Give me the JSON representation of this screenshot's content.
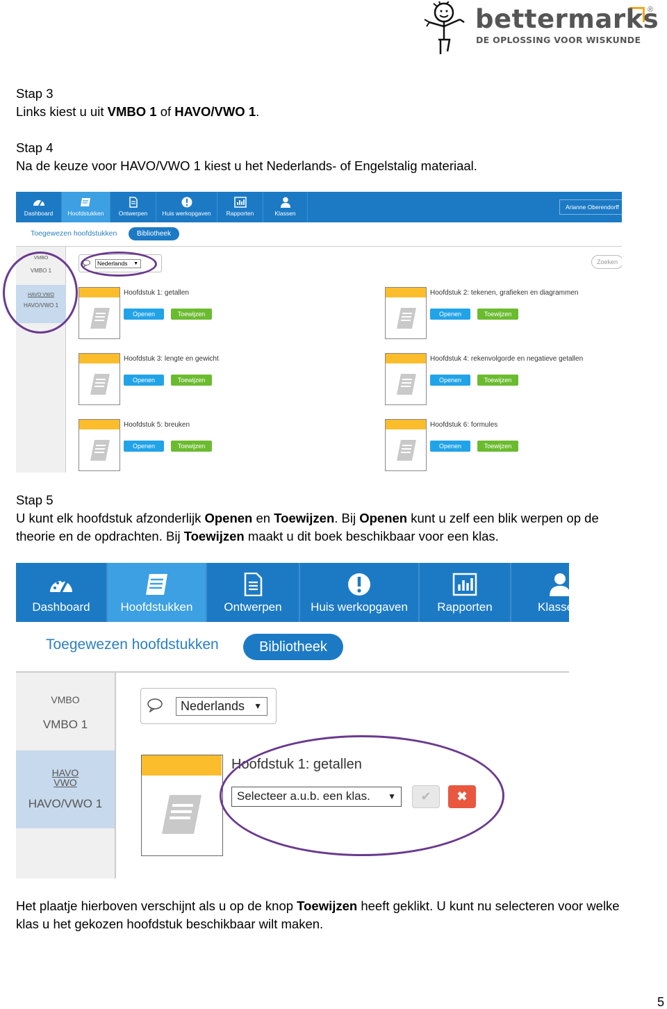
{
  "logo": {
    "word": "bettermarks",
    "reg": "®",
    "tagline": "DE OPLOSSING VOOR WISKUNDE"
  },
  "step3": {
    "title": "Stap 3",
    "line_pre": "Links kiest u uit ",
    "opt1": "VMBO 1",
    "mid": " of ",
    "opt2": "HAVO/VWO 1",
    "end": "."
  },
  "step4": {
    "title": "Stap 4",
    "text": "Na de keuze voor HAVO/VWO 1 kiest u het Nederlands- of Engelstalig materiaal."
  },
  "shot1": {
    "nav": [
      {
        "label": "Dashboard",
        "icon": "dashboard-icon"
      },
      {
        "label": "Hoofdstukken",
        "icon": "book-icon"
      },
      {
        "label": "Ontwerpen",
        "icon": "document-icon"
      },
      {
        "label": "Huis werkopgaven",
        "icon": "exclamation-icon"
      },
      {
        "label": "Rapporten",
        "icon": "bar-chart-icon"
      },
      {
        "label": "Klassen",
        "icon": "person-icon"
      }
    ],
    "user": "Arianne Oberendorff",
    "tab_assigned": "Toegewezen hoofdstukken",
    "tab_library": "Bibliotheek",
    "sidebar": [
      {
        "head": "VMBO",
        "label": "VMBO 1"
      },
      {
        "head": "HAVO VWO",
        "label": "HAVO/VWO 1"
      }
    ],
    "language": "Nederlands",
    "search_placeholder": "Zoeken",
    "open_label": "Openen",
    "assign_label": "Toewijzen",
    "chapters": [
      "Hoofdstuk 1: getallen",
      "Hoofdstuk 2: tekenen, grafieken en diagrammen",
      "Hoofdstuk 3: lengte en gewicht",
      "Hoofdstuk 4: rekenvolgorde en negatieve getallen",
      "Hoofdstuk 5: breuken",
      "Hoofdstuk 6: formules"
    ]
  },
  "step5": {
    "title": "Stap 5",
    "l1_a": "U kunt elk hoofdstuk afzonderlijk ",
    "l1_b": "Openen",
    "l1_c": " en ",
    "l1_d": "Toewijzen",
    "l1_e": ". Bij ",
    "l1_f": "Openen",
    "l1_g": " kunt u zelf een blik werpen op de",
    "l2_a": "theorie en de opdrachten. Bij ",
    "l2_b": "Toewijzen",
    "l2_c": " maakt u dit boek beschikbaar voor een klas."
  },
  "shot2": {
    "nav": [
      {
        "label": "Dashboard",
        "icon": "dashboard-icon"
      },
      {
        "label": "Hoofdstukken",
        "icon": "book-icon"
      },
      {
        "label": "Ontwerpen",
        "icon": "document-icon"
      },
      {
        "label": "Huis werkopgaven",
        "icon": "exclamation-icon"
      },
      {
        "label": "Rapporten",
        "icon": "bar-chart-icon"
      },
      {
        "label": "Klasse",
        "icon": "person-icon"
      }
    ],
    "tab_assigned": "Toegewezen hoofdstukken",
    "tab_library": "Bibliotheek",
    "sidebar": [
      {
        "head": "VMBO",
        "label": "VMBO 1"
      },
      {
        "head1": "HAVO",
        "head2": "VWO",
        "label": "HAVO/VWO 1"
      }
    ],
    "language": "Nederlands",
    "chapter": "Hoofdstuk 1: getallen",
    "class_select": "Selecteer a.u.b. een klas."
  },
  "closing": {
    "l1_a": "Het plaatje hierboven verschijnt als u op de knop ",
    "l1_b": "Toewijzen",
    "l1_c": " heeft geklikt. U kunt nu selecteren voor welke",
    "l2": "klas u het gekozen hoofdstuk beschikbaar wilt maken."
  },
  "page_number": "5",
  "colors": {
    "nav_blue": "#1c7ac5",
    "nav_active": "#3da0e3",
    "open_button": "#21a3e8",
    "assign_button": "#6bbb2f",
    "cover_band": "#fbbd2c",
    "highlight_ring": "#6a3a8e",
    "cancel_button": "#e9573f"
  }
}
